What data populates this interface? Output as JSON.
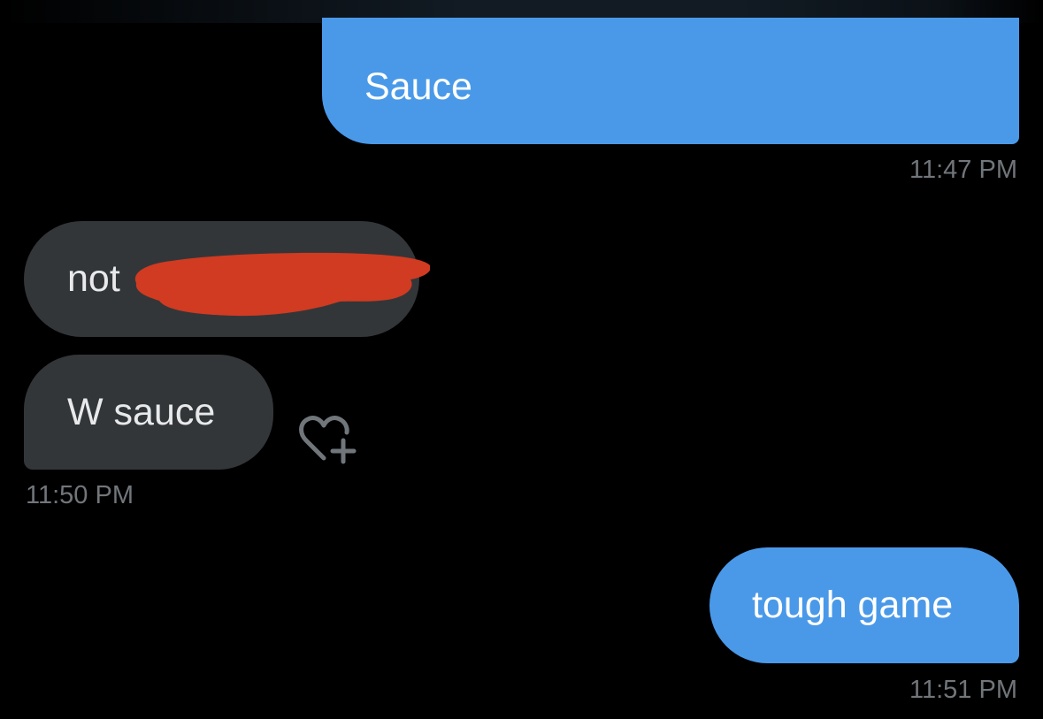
{
  "conversation": {
    "messages": [
      {
        "text": "Sauce",
        "direction": "sent"
      },
      {
        "text": "not",
        "direction": "received",
        "redacted": true
      },
      {
        "text": "W sauce",
        "direction": "received"
      },
      {
        "text": "tough game",
        "direction": "sent"
      }
    ],
    "timestamps": [
      "11:47 PM",
      "11:50 PM",
      "11:51 PM"
    ],
    "reaction_icon": "heart-plus-icon"
  },
  "colors": {
    "sent_bubble": "#4a99e9",
    "received_bubble": "#333639",
    "redaction": "#d03b21",
    "timestamp": "#71767b",
    "background": "#000000"
  }
}
